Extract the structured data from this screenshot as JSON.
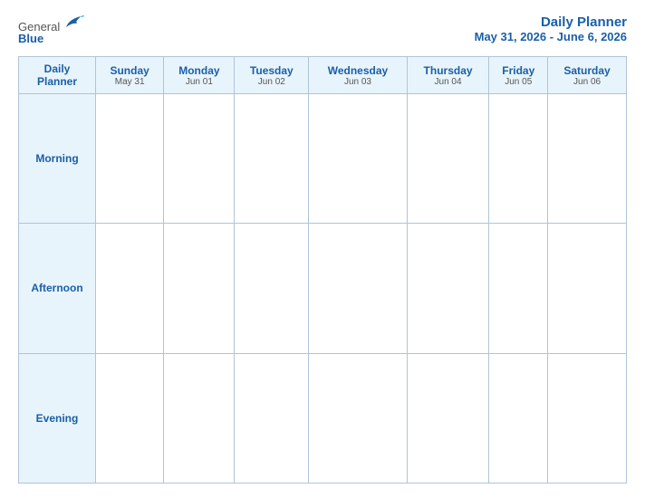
{
  "header": {
    "logo": {
      "general_text": "General",
      "blue_text": "Blue"
    },
    "title": "Daily Planner",
    "subtitle": "May 31, 2026 - June 6, 2026"
  },
  "calendar": {
    "header_label": "Daily\nPlanner",
    "columns": [
      {
        "day": "Sunday",
        "date": "May 31"
      },
      {
        "day": "Monday",
        "date": "Jun 01"
      },
      {
        "day": "Tuesday",
        "date": "Jun 02"
      },
      {
        "day": "Wednesday",
        "date": "Jun 03"
      },
      {
        "day": "Thursday",
        "date": "Jun 04"
      },
      {
        "day": "Friday",
        "date": "Jun 05"
      },
      {
        "day": "Saturday",
        "date": "Jun 06"
      }
    ],
    "rows": [
      {
        "label": "Morning"
      },
      {
        "label": "Afternoon"
      },
      {
        "label": "Evening"
      }
    ]
  }
}
